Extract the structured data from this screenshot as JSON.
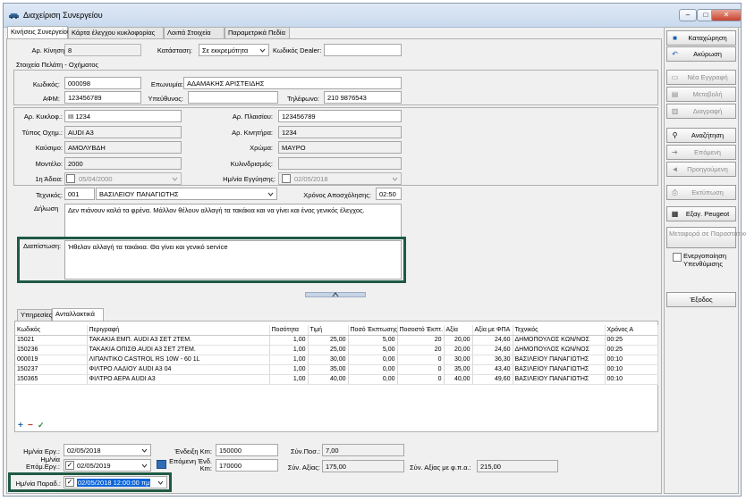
{
  "window": {
    "title": "Διαχείριση Συνεργείου",
    "min": "–",
    "max": "□",
    "close": "✕"
  },
  "tabs": [
    "Κινήσεις Συνεργείου",
    "Κάρτα έλεγχου κυκλοφορίας",
    "Λοιπά Στοιχεία",
    "Παραμετρικά Πεδία"
  ],
  "header": {
    "move_no_label": "Αρ. Κίνησης:",
    "move_no": "8",
    "status_label": "Κατάσταση:",
    "status": "Σε εκκρεμότητα",
    "dealer_label": "Κωδικός Dealer:",
    "dealer": ""
  },
  "customer": {
    "section_label": "Στοιχεία Πελάτη - Οχήματος",
    "code_label": "Κωδικός:",
    "code": "000098",
    "name_label": "Επωνυμία:",
    "name": "ΑΔΑΜΑΚΗΣ ΑΡΙΣΤΕΙΔΗΣ",
    "afm_label": "ΑΦΜ:",
    "afm": "123456789",
    "resp_label": "Υπεύθυνος:",
    "resp": "",
    "phone_label": "Τηλέφωνο:",
    "phone": "210 9876543"
  },
  "vehicle": {
    "plate_label": "Αρ. Κυκλοφ.:",
    "plate": "ΙΙΙ 1234",
    "chassis_label": "Αρ. Πλαισίου:",
    "chassis": "123456789",
    "type_label": "Τύπος Οχημ.:",
    "type": "AUDI A3",
    "engine_label": "Αρ. Κινητήρα:",
    "engine": "1234",
    "fuel_label": "Καύσιμο:",
    "fuel": "ΑΜΟΛΥΒΔΗ",
    "color_label": "Χρώμα:",
    "color": "ΜΑΥΡΟ",
    "model_label": "Μοντέλο:",
    "model": "2000",
    "cc_label": "Κυλινδρισμός:",
    "cc": "",
    "first_label": "1η Άδεια:",
    "first": "05/04/2000",
    "warranty_label": "Ημ/νία Εγγύησης:",
    "warranty": "02/05/2018"
  },
  "work": {
    "tech_label": "Τεχνικός:",
    "tech_code": "001",
    "tech_name": "ΒΑΣΙΛΕΙΟΥ ΠΑΝΑΓΙΩΤΗΣ",
    "time_label": "Χρόνος Αποσχόλησης:",
    "time": "02:50",
    "decl_label": "Δήλωση",
    "decl": "Δεν πιάνουν καλά τα φρένα. Μάλλον θέλουν αλλαγή τα τακάκια και να γίνει και ένας γενικός έλεγχος.",
    "diag_label": "Διαπίστωση:",
    "diag": "Ήθελαν αλλαγή τα τακάκια. Θα γίνει και γενικό service"
  },
  "subtabs": [
    "Υπηρεσίες",
    "Ανταλλακτικά"
  ],
  "parts": {
    "columns": [
      "Κωδικός",
      "Περιγραφή",
      "Ποσότητα",
      "Τιμή",
      "Ποσό Έκπτωσης",
      "Ποσοστό Έκπτ.",
      "Αξία",
      "Αξία με ΦΠΑ",
      "Τεχνικός",
      "Χρόνος Α"
    ],
    "rows": [
      [
        "15021",
        "ΤΑΚΑΚΙΑ ΕΜΠ. AUDI A3 ΣΕΤ 2ΤΕΜ.",
        "1,00",
        "25,00",
        "5,00",
        "20",
        "20,00",
        "24,60",
        "ΔΗΜΟΠΟΥΛΟΣ ΚΩΝ/ΝΟΣ",
        "00:25"
      ],
      [
        "150236",
        "ΤΑΚΑΚΙΑ ΟΠΙΣΘ.AUDI A3 ΣΕΤ 2ΤΕΜ.",
        "1,00",
        "25,00",
        "5,00",
        "20",
        "20,00",
        "24,60",
        "ΔΗΜΟΠΟΥΛΟΣ ΚΩΝ/ΝΟΣ",
        "00:25"
      ],
      [
        "000019",
        "ΛΙΠΑΝΤΙΚΟ CASTROL RS 10W - 60 1L",
        "1,00",
        "30,00",
        "0,00",
        "0",
        "30,00",
        "36,30",
        "ΒΑΣΙΛΕΙΟΥ ΠΑΝΑΓΙΩΤΗΣ",
        "00:10"
      ],
      [
        "150237",
        "ΦΙΛΤΡΟ ΛΑΔΙΟΥ AUDI A3 04",
        "1,00",
        "35,00",
        "0,00",
        "0",
        "35,00",
        "43,40",
        "ΒΑΣΙΛΕΙΟΥ ΠΑΝΑΓΙΩΤΗΣ",
        "00:10"
      ],
      [
        "150365",
        "ΦΙΛΤΡΟ ΑΕΡΑ AUDI A3",
        "1,00",
        "40,00",
        "0,00",
        "0",
        "40,00",
        "49,60",
        "ΒΑΣΙΛΕΙΟΥ ΠΑΝΑΓΙΩΤΗΣ",
        "00:10"
      ]
    ]
  },
  "grid_tools": [
    "+",
    "−",
    "✓"
  ],
  "footer": {
    "work_date_label": "Ημ/νία Εργ.:",
    "work_date": "02/05/2018",
    "next_date_label": "Ημ/νία Επόμ.Εργ.:",
    "next_date": "02/05/2019",
    "deliv_label": "Ημ/νία Παραδ.:",
    "deliv": "02/05/2018 12:00:00 πμ",
    "km_label": "Ένδειξη Km:",
    "km": "150000",
    "next_km_label": "Επόμενη Ένδ. Km:",
    "next_km": "170000",
    "qty_label": "Σύν.Ποσ.:",
    "qty": "7,00",
    "value_label": "Σύν. Αξίας:",
    "value": "175,00",
    "vat_label": "Σύν. Αξίας με φ.π.α.:",
    "vat": "215,00"
  },
  "actions": {
    "save": "Καταχώρηση",
    "cancel": "Ακύρωση",
    "new": "Νέα Εγγραφή",
    "edit": "Μεταβολή",
    "delete": "Διαγραφή",
    "search": "Αναζήτηση",
    "next": "Επόμενη",
    "prev": "Προηγούμενη",
    "print": "Εκτύπωση",
    "export": "Εξαγ. Peugeot",
    "transfer": "Μεταφορά σε Παραστατικό",
    "reminder": "Ενεργοποίηση Υπενθύμισης",
    "exit": "Έξοδος"
  },
  "colors": {
    "accent": "#1f5a44",
    "selection": "#0a64d8"
  }
}
